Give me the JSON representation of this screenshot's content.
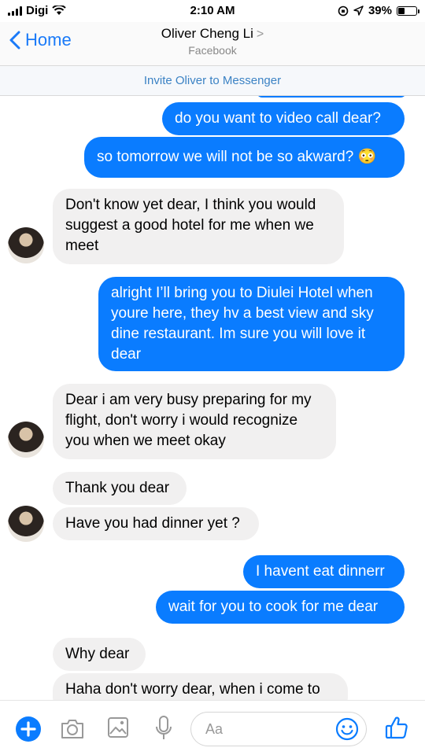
{
  "status": {
    "carrier": "Digi",
    "time": "2:10 AM",
    "battery": "39%",
    "battery_fraction": 0.39
  },
  "header": {
    "back_label": "Home",
    "title": "Oliver Cheng Li",
    "chevron": ">",
    "subtitle": "Facebook"
  },
  "invite_label": "Invite Oliver to Messenger",
  "messages": {
    "m1": "do you want to video call dear?",
    "m2": "so tomorrow we will not be so akward? 😳",
    "m3": "Don't know yet dear, I think you would suggest a good hotel for me when we meet",
    "m4": "alright I’ll bring you to Diulei Hotel when youre here, they hv a best view  and sky dine restaurant. Im sure you will love it dear",
    "m5": "Dear i am very busy preparing for my flight, don't worry i would recognize you when we meet okay",
    "m6": "Thank you dear",
    "m7": "Have you had dinner yet ?",
    "m8": "I havent eat dinnerr",
    "m9": "wait for you to cook for me dear",
    "m10": "Why dear",
    "m11": "Haha don't worry dear, when i come to"
  },
  "composer": {
    "placeholder": "Aa"
  },
  "colors": {
    "outgoing": "#0a7cff",
    "incoming": "#f1f0f0",
    "accent": "#1a7af8"
  }
}
